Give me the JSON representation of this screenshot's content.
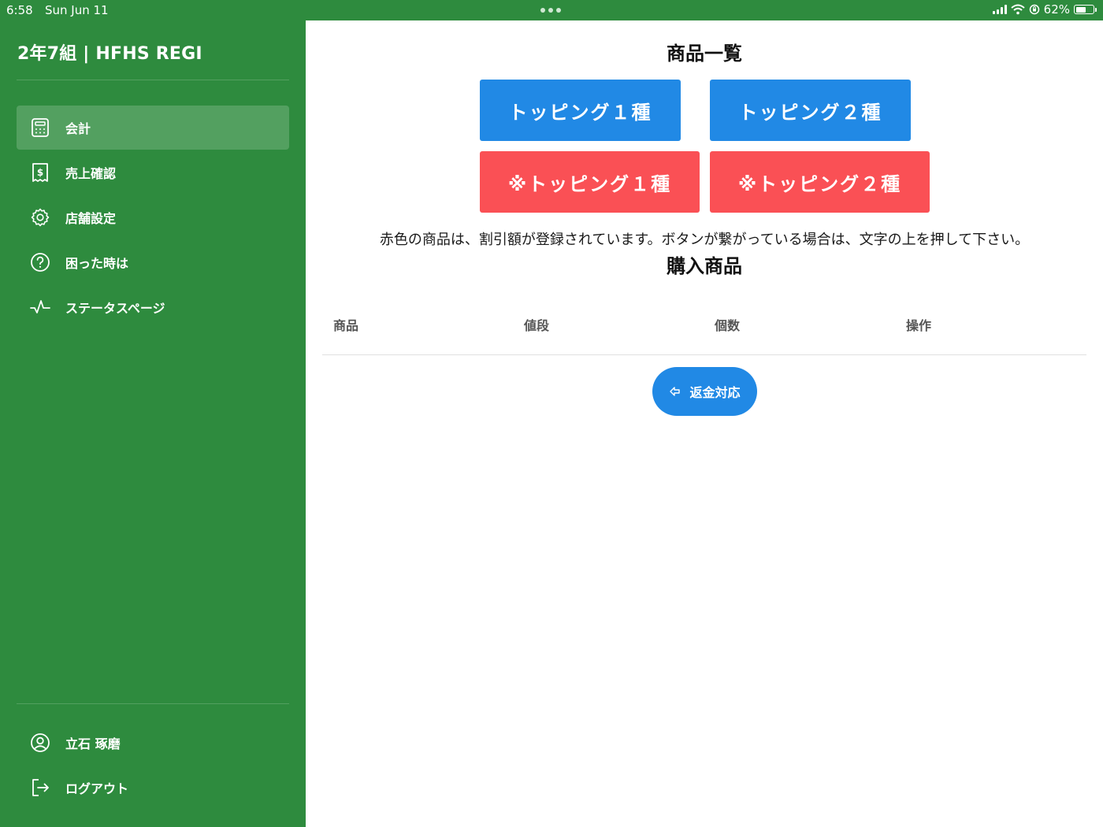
{
  "status_bar": {
    "time": "6:58",
    "date": "Sun Jun 11",
    "battery_percent": "62%",
    "battery_level": 0.62
  },
  "sidebar": {
    "title": "2年7組 | HFHS REGI",
    "items": [
      {
        "label": "会計",
        "icon": "calculator-icon",
        "active": true
      },
      {
        "label": "売上確認",
        "icon": "receipt-icon",
        "active": false
      },
      {
        "label": "店舗設定",
        "icon": "gear-icon",
        "active": false
      },
      {
        "label": "困った時は",
        "icon": "help-circle-icon",
        "active": false
      },
      {
        "label": "ステータスページ",
        "icon": "activity-icon",
        "active": false
      }
    ],
    "bottom_items": [
      {
        "label": "立石 琢磨",
        "icon": "user-circle-icon"
      },
      {
        "label": "ログアウト",
        "icon": "logout-icon"
      }
    ]
  },
  "main": {
    "product_list_title": "商品一覧",
    "products": [
      {
        "label": "トッピング１種",
        "color": "#2189e5"
      },
      {
        "label": "トッピング２種",
        "color": "#2189e5"
      },
      {
        "label": "※トッピング１種",
        "color": "#fa5055"
      },
      {
        "label": "※トッピング２種",
        "color": "#fa5055"
      }
    ],
    "notice": "赤色の商品は、割引額が登録されています。ボタンが繋がっている場合は、文字の上を押して下さい。",
    "purchase_title": "購入商品",
    "table_headers": [
      "商品",
      "値段",
      "個数",
      "操作"
    ],
    "refund_label": "返金対応"
  },
  "colors": {
    "sidebar_bg": "#2e8b3e",
    "primary_blue": "#2189e5",
    "discount_red": "#fa5055"
  }
}
